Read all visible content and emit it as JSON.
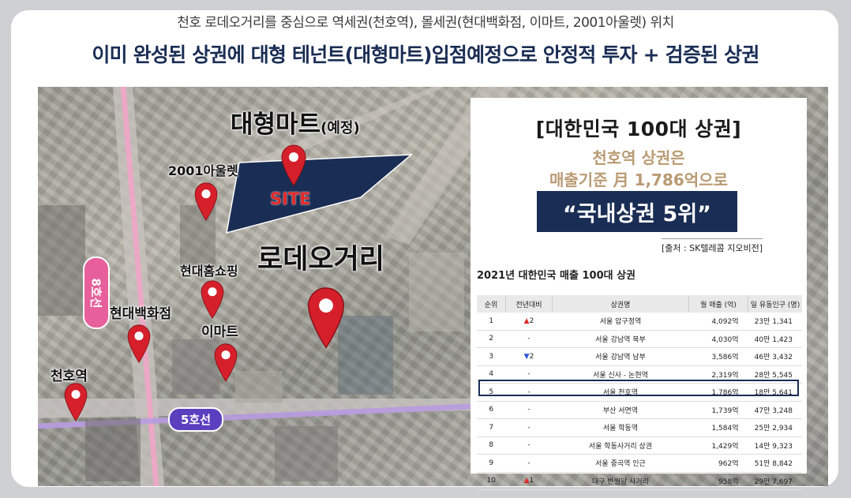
{
  "header": {
    "subtitle": "천호 로데오거리를 중심으로 역세권(천호역), 몰세권(현대백화점, 이마트, 2001아울렛) 위치",
    "headline": "이미 완성된 상권에 대형 테넌트(대형마트)입점예정으로 안정적 투자 + 검증된 상권"
  },
  "map": {
    "big_mart_label": "대형마트",
    "big_mart_suffix": "(예정)",
    "site_label": "SITE",
    "rodeo_label": "로데오거리",
    "outlet_label": "2001아울렛",
    "homeshopping_label": "현대홈쇼핑",
    "dept_store_label": "현대백화점",
    "emart_label": "이마트",
    "station_label": "천호역",
    "line8_label": "8호선",
    "line5_label": "5호선"
  },
  "info": {
    "title": "[대한민국 100대 상권]",
    "line1": "천호역 상권은",
    "line2": "매출기준 月 1,786억으로",
    "rank_text": "“국내상권 5위”",
    "source": "[출처 : SK텔레콤 지오비전]"
  },
  "table": {
    "title": "2021년 대한민국 매출 100대 상권",
    "headers": [
      "순위",
      "전년대비",
      "상권명",
      "월 매출 (억)",
      "일 유동인구 (명)"
    ],
    "rows": [
      {
        "rank": "1",
        "change": "2",
        "dir": "up",
        "name": "서울 압구정역",
        "sales": "4,092억",
        "pop": "23만 1,341"
      },
      {
        "rank": "2",
        "change": "-",
        "dir": "",
        "name": "서울 강남역 북부",
        "sales": "4,030억",
        "pop": "40만 1,423"
      },
      {
        "rank": "3",
        "change": "2",
        "dir": "down",
        "name": "서울 강남역 남부",
        "sales": "3,586억",
        "pop": "46만 3,432"
      },
      {
        "rank": "4",
        "change": "-",
        "dir": "",
        "name": "서울 신사 - 논현역",
        "sales": "2,319억",
        "pop": "28만 5,545"
      },
      {
        "rank": "5",
        "change": "-",
        "dir": "",
        "name": "서울 천호역",
        "sales": "1,786억",
        "pop": "18만 5,641"
      },
      {
        "rank": "6",
        "change": "-",
        "dir": "",
        "name": "부산 서면역",
        "sales": "1,739억",
        "pop": "47만 3,248"
      },
      {
        "rank": "7",
        "change": "-",
        "dir": "",
        "name": "서울 학동역",
        "sales": "1,584억",
        "pop": "25만 2,934"
      },
      {
        "rank": "8",
        "change": "-",
        "dir": "",
        "name": "서울 학동사거리 상권",
        "sales": "1,429억",
        "pop": "14만 9,323"
      },
      {
        "rank": "9",
        "change": "-",
        "dir": "",
        "name": "서울 중곡역 인근",
        "sales": "962억",
        "pop": "51만 8,842"
      },
      {
        "rank": "10",
        "change": "1",
        "dir": "up",
        "name": "대구 반월당 사거리",
        "sales": "958억",
        "pop": "29만 7,697"
      }
    ]
  },
  "colors": {
    "navy": "#1a2d54",
    "pin_red": "#d5202b",
    "line5": "#5b3fbf",
    "line8": "#e7609b",
    "gold_text": "#b99a73"
  },
  "icons": [
    "location-pin-icon",
    "triangle-up-icon",
    "triangle-down-icon"
  ]
}
